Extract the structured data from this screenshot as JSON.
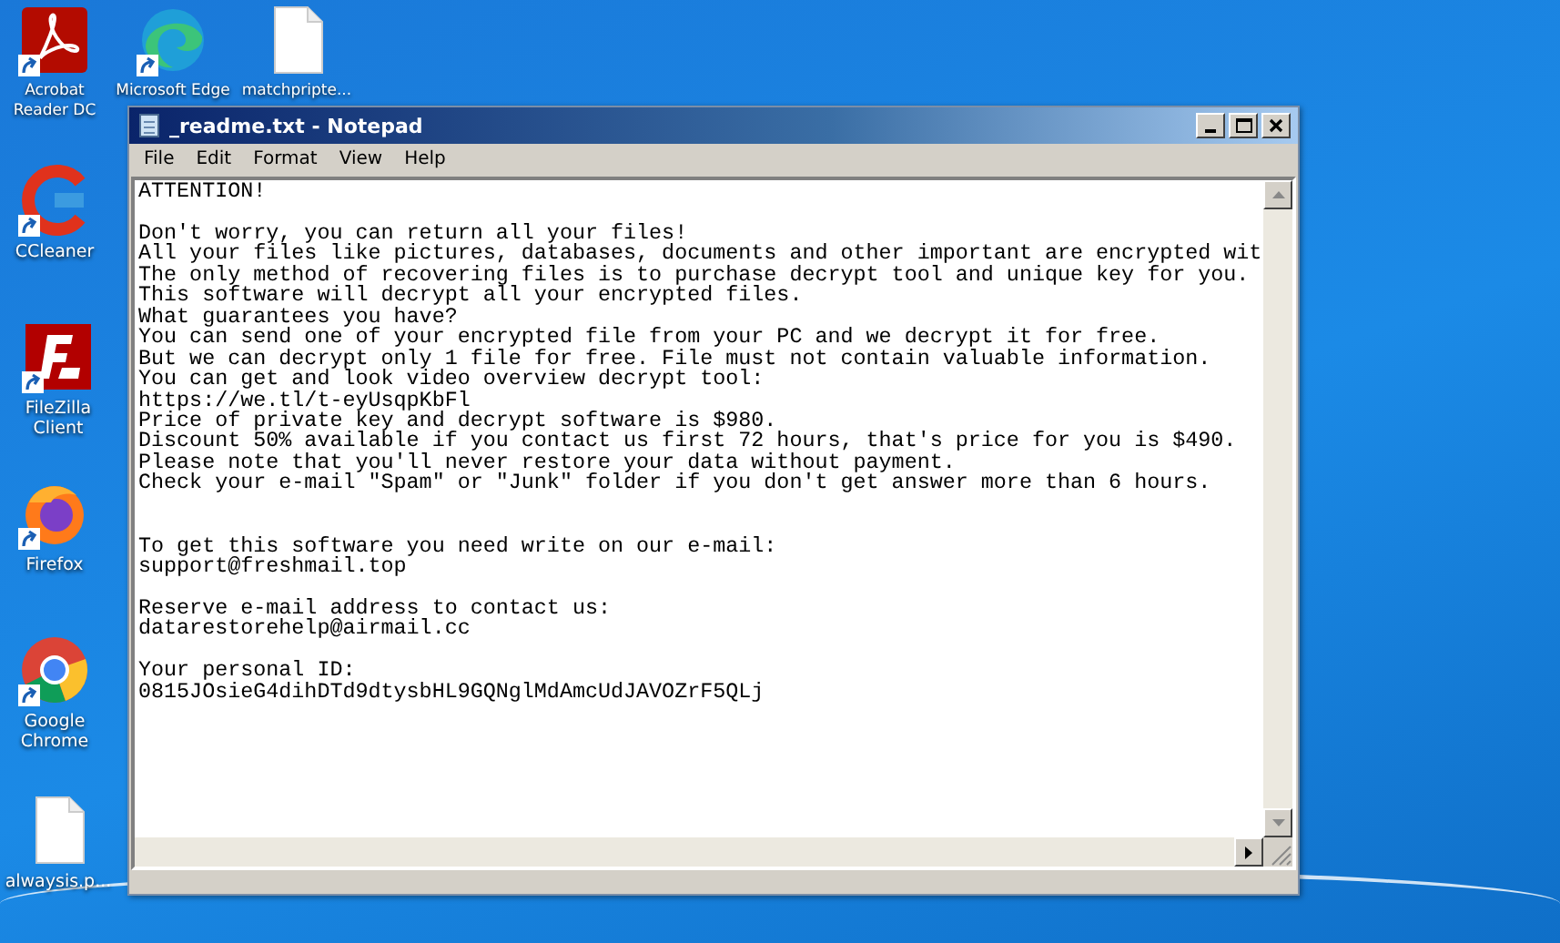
{
  "desktop_icons": [
    {
      "label": "Acrobat Reader DC",
      "kind": "acrobat",
      "shortcut": true
    },
    {
      "label": "Microsoft Edge",
      "kind": "edge",
      "shortcut": true
    },
    {
      "label": "matchpripte...",
      "kind": "file",
      "shortcut": false
    },
    {
      "label": "CCleaner",
      "kind": "ccleaner",
      "shortcut": true
    },
    {
      "label": "FileZilla Client",
      "kind": "filezilla",
      "shortcut": true
    },
    {
      "label": "Firefox",
      "kind": "firefox",
      "shortcut": true
    },
    {
      "label": "Google Chrome",
      "kind": "chrome",
      "shortcut": true
    },
    {
      "label": "alwaysis.p...",
      "kind": "file",
      "shortcut": false
    }
  ],
  "window": {
    "title": "_readme.txt - Notepad",
    "menu": [
      "File",
      "Edit",
      "Format",
      "View",
      "Help"
    ],
    "document": [
      [
        "ATTENTION!"
      ],
      [
        "Don't worry, you can return all your files!",
        "All your files like pictures, databases, documents and other important are encrypted wit",
        "The only method of recovering files is to purchase decrypt tool and unique key for you.",
        "This software will decrypt all your encrypted files.",
        "What guarantees you have?",
        "You can send one of your encrypted file from your PC and we decrypt it for free.",
        "But we can decrypt only 1 file for free. File must not contain valuable information.",
        "You can get and look video overview decrypt tool:",
        "https://we.tl/t-eyUsqpKbFl",
        "Price of private key and decrypt software is $980.",
        "Discount 50% available if you contact us first 72 hours, that's price for you is $490.",
        "Please note that you'll never restore your data without payment.",
        "Check your e-mail \"Spam\" or \"Junk\" folder if you don't get answer more than 6 hours."
      ],
      [
        "To get this software you need write on our e-mail:",
        "support@freshmail.top"
      ],
      [
        "Reserve e-mail address to contact us:",
        "datarestorehelp@airmail.cc"
      ],
      [
        "Your personal ID:",
        "0815JOsieG4dihDTd9dtysbHL9GQNglMdAmcUdJAVOZrF5QLj"
      ]
    ]
  }
}
